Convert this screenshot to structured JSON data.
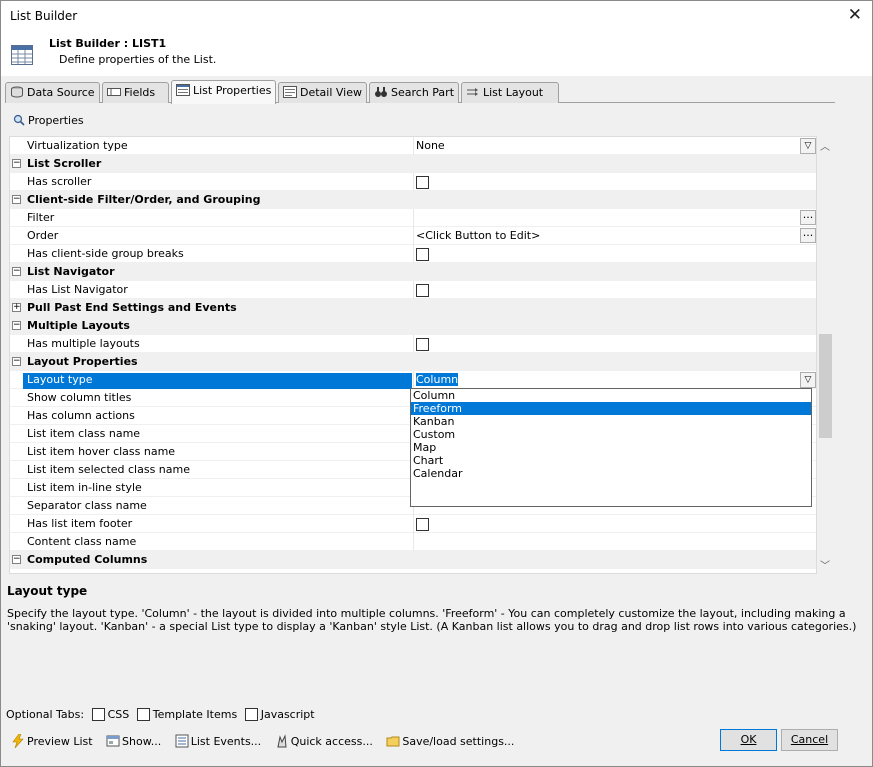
{
  "window": {
    "title": "List Builder",
    "close_glyph": "✕"
  },
  "header": {
    "title": "List Builder : LIST1",
    "subtitle": "Define properties of the List."
  },
  "tabs": [
    {
      "label": "Data Source",
      "icon": "database-icon"
    },
    {
      "label": "Fields",
      "icon": "fields-icon"
    },
    {
      "label": "List Properties",
      "icon": "list-properties-icon",
      "active": true
    },
    {
      "label": "Detail View",
      "icon": "detail-view-icon"
    },
    {
      "label": "Search Part",
      "icon": "binoculars-icon"
    },
    {
      "label": "List Layout",
      "icon": "list-layout-icon"
    }
  ],
  "properties_label": "Properties",
  "grid": {
    "rows": [
      {
        "type": "prop",
        "name": "Virtualization type",
        "value": "None",
        "editor": "dropdown"
      },
      {
        "type": "cat",
        "name": "List Scroller",
        "expander": "−"
      },
      {
        "type": "prop",
        "name": "Has scroller",
        "editor": "checkbox"
      },
      {
        "type": "cat",
        "name": "Client-side Filter/Order,  and Grouping",
        "expander": "−"
      },
      {
        "type": "prop",
        "name": "Filter",
        "value": "",
        "editor": "ellipsis"
      },
      {
        "type": "prop",
        "name": "Order",
        "value": "<Click Button to Edit>",
        "editor": "ellipsis"
      },
      {
        "type": "prop",
        "name": "Has client-side group breaks",
        "editor": "checkbox"
      },
      {
        "type": "cat",
        "name": "List Navigator",
        "expander": "−"
      },
      {
        "type": "prop",
        "name": "Has List Navigator",
        "editor": "checkbox"
      },
      {
        "type": "cat",
        "name": "Pull Past End Settings and Events",
        "expander": "+"
      },
      {
        "type": "cat",
        "name": "Multiple Layouts",
        "expander": "−"
      },
      {
        "type": "prop",
        "name": "Has multiple layouts",
        "editor": "checkbox"
      },
      {
        "type": "cat",
        "name": "Layout Properties",
        "expander": "−"
      },
      {
        "type": "prop",
        "name": "Layout type",
        "value": "Column",
        "editor": "dropdown",
        "selected": true
      },
      {
        "type": "prop",
        "name": "Show column titles"
      },
      {
        "type": "prop",
        "name": "Has column actions"
      },
      {
        "type": "prop",
        "name": "List item class name"
      },
      {
        "type": "prop",
        "name": "List item hover class name"
      },
      {
        "type": "prop",
        "name": "List item selected class name"
      },
      {
        "type": "prop",
        "name": "List item in-line style"
      },
      {
        "type": "prop",
        "name": "Separator class name"
      },
      {
        "type": "prop",
        "name": "Has list item footer",
        "editor": "checkbox"
      },
      {
        "type": "prop",
        "name": "Content class name"
      },
      {
        "type": "cat",
        "name": "Computed Columns",
        "expander": "−"
      }
    ]
  },
  "dropdown": {
    "options": [
      "Column",
      "Freeform",
      "Kanban",
      "Custom",
      "Map",
      "Chart",
      "Calendar"
    ],
    "highlighted": "Freeform"
  },
  "description": {
    "title": "Layout type",
    "text": "Specify the layout type. 'Column' - the layout is divided into multiple columns. 'Freeform' - You can completely customize the layout, including making a 'snaking' layout. 'Kanban' - a special List type to display a 'Kanban' style List. (A Kanban list allows you to drag and drop list rows into various categories.)"
  },
  "optional_tabs": {
    "label": "Optional Tabs:",
    "items": [
      "CSS",
      "Template Items",
      "Javascript"
    ]
  },
  "bottom_actions": [
    {
      "label": "Preview List",
      "icon": "lightning-icon"
    },
    {
      "label": "Show...",
      "icon": "show-icon"
    },
    {
      "label": "List Events...",
      "icon": "events-icon"
    },
    {
      "label": "Quick access...",
      "icon": "quick-access-icon"
    },
    {
      "label": "Save/load settings...",
      "icon": "folder-icon"
    }
  ],
  "buttons": {
    "ok": "OK",
    "cancel": "Cancel"
  }
}
